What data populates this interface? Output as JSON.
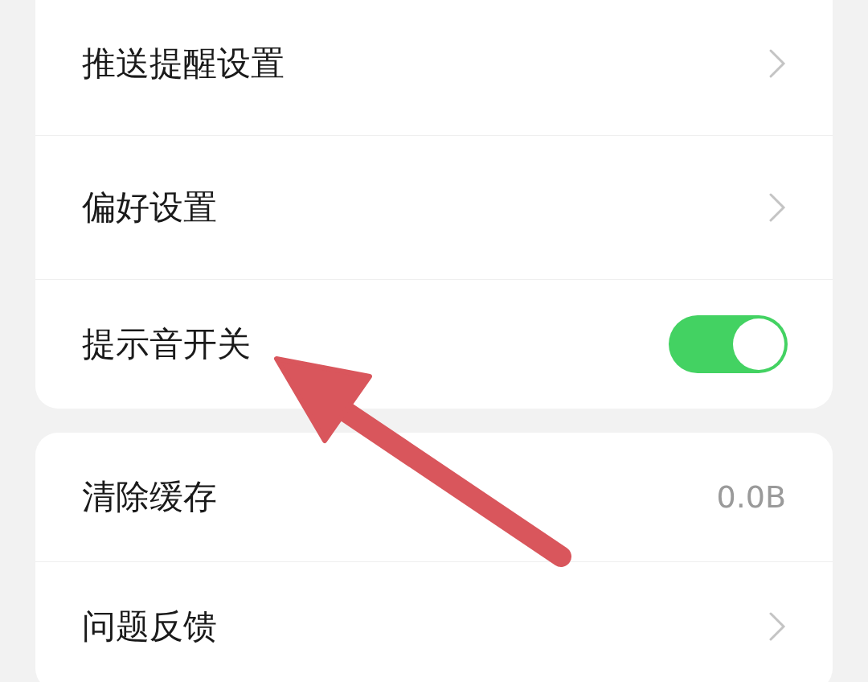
{
  "sections": [
    {
      "rows": [
        {
          "kind": "link",
          "label": "推送提醒设置"
        },
        {
          "kind": "link",
          "label": "偏好设置"
        },
        {
          "kind": "toggle",
          "label": "提示音开关",
          "on": true
        }
      ]
    },
    {
      "rows": [
        {
          "kind": "value",
          "label": "清除缓存",
          "value": "0.0B"
        },
        {
          "kind": "link",
          "label": "问题反馈"
        }
      ]
    }
  ]
}
